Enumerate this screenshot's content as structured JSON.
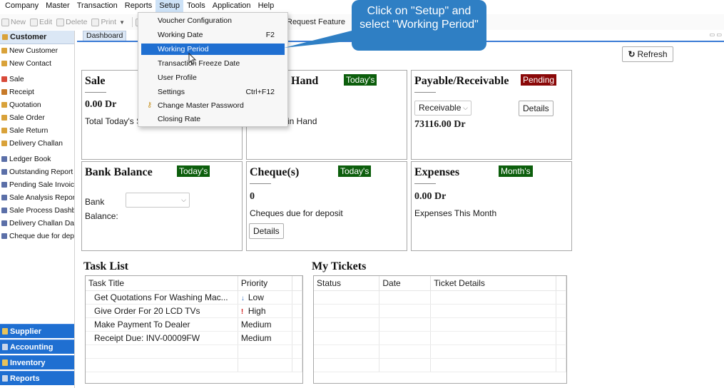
{
  "menubar": {
    "items": [
      "Company",
      "Master",
      "Transaction",
      "Reports",
      "Setup",
      "Tools",
      "Application",
      "Help"
    ]
  },
  "toolbar": {
    "new_label": "New",
    "edit_label": "Edit",
    "delete_label": "Delete",
    "print_label": "Print",
    "partial_label": "P",
    "request_feature_label": "Request Feature"
  },
  "setup_menu": {
    "items": [
      {
        "label": "Voucher Configuration",
        "shortcut": ""
      },
      {
        "label": "Working Date",
        "shortcut": "F2"
      },
      {
        "label": "Working Period",
        "shortcut": ""
      },
      {
        "label": "Transaction Freeze Date",
        "shortcut": ""
      },
      {
        "label": "User Profile",
        "shortcut": ""
      },
      {
        "label": "Settings",
        "shortcut": "Ctrl+F12"
      },
      {
        "label": "Change Master Password",
        "shortcut": ""
      },
      {
        "label": "Closing Rate",
        "shortcut": ""
      }
    ],
    "selected": "Working Period"
  },
  "callout": {
    "text": "Click on \"Setup\" and select \"Working Period\""
  },
  "sidebar": {
    "header": "Customer",
    "items": [
      "New Customer",
      "New Contact",
      "Sale",
      "Receipt",
      "Quotation",
      "Sale Order",
      "Sale Return",
      "Delivery Challan",
      "Ledger Book",
      "Outstanding Report",
      "Pending Sale Invoices",
      "Sale Analysis Report",
      "Sale Process Dashboa",
      "Delivery Challan Dashl",
      "Cheque due for depos"
    ],
    "groups": [
      "Supplier",
      "Accounting",
      "Inventory",
      "Reports"
    ]
  },
  "tabs": {
    "dashboard": "Dashboard"
  },
  "dashboard": {
    "refresh_label": "Refresh",
    "sale": {
      "title": "Sale",
      "value": "0.00 Dr",
      "subtitle": "Total Today's S"
    },
    "cash_in_hand": {
      "title": "Hand",
      "badge": "Today's",
      "subtitle": "in Hand"
    },
    "payable_receivable": {
      "title": "Payable/Receivable",
      "badge": "Pending",
      "select_value": "Receivable",
      "value": "73116.00 Dr",
      "details_label": "Details"
    },
    "bank_balance": {
      "title": "Bank Balance",
      "badge": "Today's",
      "bank_label": "Bank",
      "balance_label": "Balance:"
    },
    "cheques": {
      "title": "Cheque(s)",
      "badge": "Today's",
      "value": "0",
      "subtitle": "Cheques due for deposit",
      "details_label": "Details"
    },
    "expenses": {
      "title": "Expenses",
      "badge": "Month's",
      "value": "0.00 Dr",
      "subtitle": "Expenses This Month"
    },
    "task_list": {
      "title": "Task List",
      "columns": [
        "Task Title",
        "Priority"
      ],
      "rows": [
        {
          "title": "Get Quotations For Washing Mac...",
          "priority": "Low",
          "priority_icon": "↓"
        },
        {
          "title": "Give Order For 20 LCD TVs",
          "priority": "High",
          "priority_icon": "!"
        },
        {
          "title": "Make Payment To Dealer",
          "priority": "Medium",
          "priority_icon": ""
        },
        {
          "title": "Receipt Due: INV-00009FW",
          "priority": "Medium",
          "priority_icon": ""
        }
      ]
    },
    "my_tickets": {
      "title": "My Tickets",
      "columns": [
        "Status",
        "Date",
        "Ticket Details"
      ]
    }
  },
  "colors": {
    "accent_blue": "#1f6fd1",
    "badge_green": "#0c5e0c",
    "badge_red": "#8a0808",
    "callout_blue": "#2f7fc4"
  }
}
